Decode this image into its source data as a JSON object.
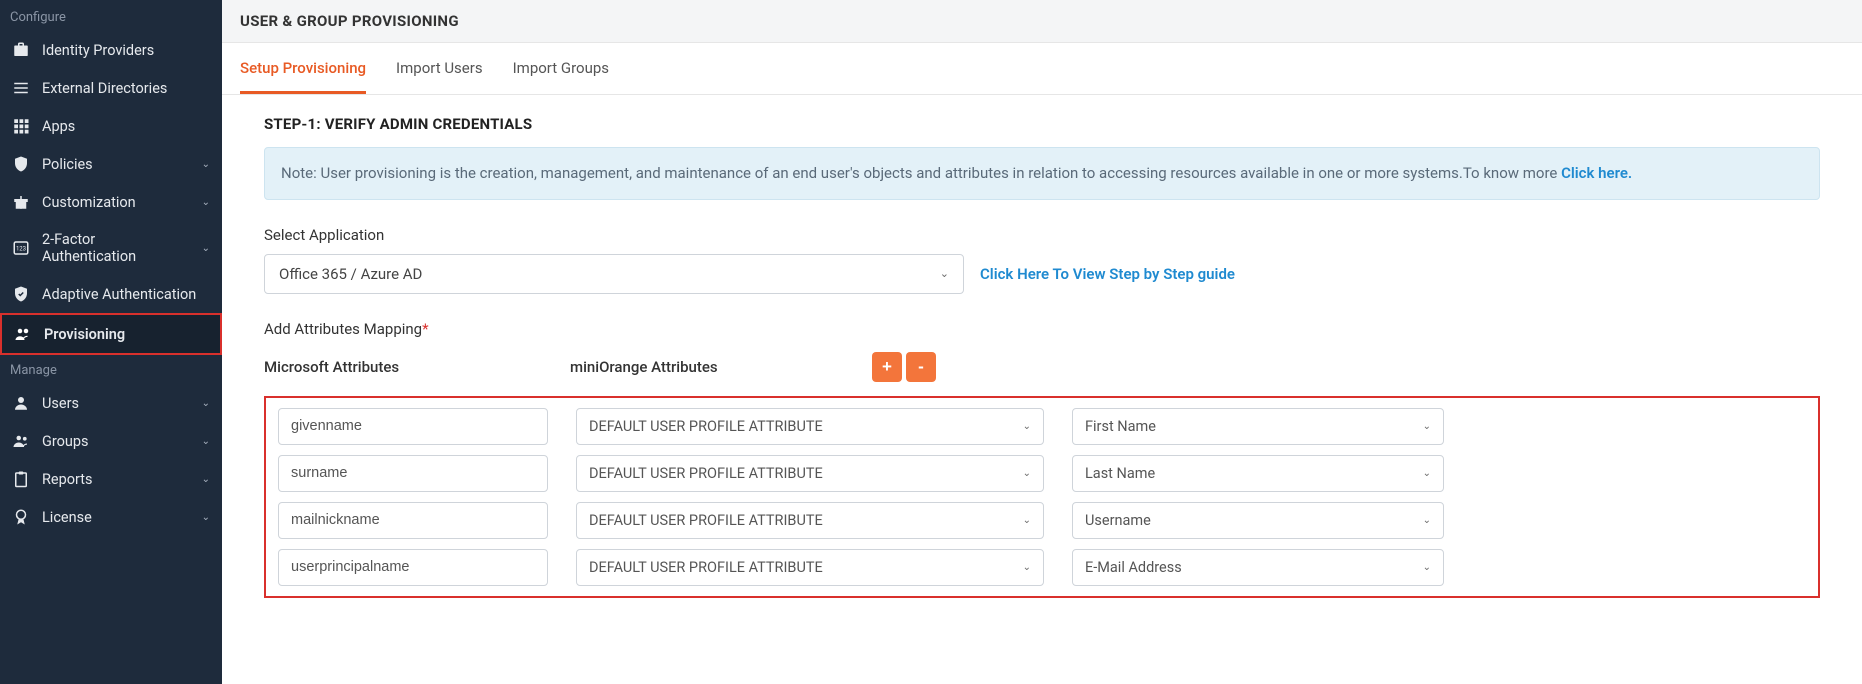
{
  "sidebar": {
    "section_configure": "Configure",
    "section_manage": "Manage",
    "items": {
      "identity_providers": "Identity Providers",
      "external_directories": "External Directories",
      "apps": "Apps",
      "policies": "Policies",
      "customization": "Customization",
      "two_factor_auth": "2-Factor Authentication",
      "adaptive_auth": "Adaptive Authentication",
      "provisioning": "Provisioning",
      "users": "Users",
      "groups": "Groups",
      "reports": "Reports",
      "license": "License"
    }
  },
  "header": {
    "title": "USER & GROUP PROVISIONING"
  },
  "tabs": {
    "setup": "Setup Provisioning",
    "import_users": "Import Users",
    "import_groups": "Import Groups"
  },
  "step": {
    "title": "STEP-1: VERIFY ADMIN CREDENTIALS"
  },
  "note": {
    "text": "Note: User provisioning is the creation, management, and maintenance of an end user's objects and attributes in relation to accessing resources available in one or more systems.To know more ",
    "link": "Click here."
  },
  "select_app": {
    "label": "Select Application",
    "value": "Office 365 / Azure AD",
    "guide_link": "Click Here To View Step by Step guide"
  },
  "attr": {
    "label": "Add Attributes Mapping",
    "col_ms": "Microsoft Attributes",
    "col_mo": "miniOrange Attributes",
    "add": "+",
    "remove": "-",
    "rows": [
      {
        "ms": "givenname",
        "type": "DEFAULT USER PROFILE ATTRIBUTE",
        "mo": "First Name"
      },
      {
        "ms": "surname",
        "type": "DEFAULT USER PROFILE ATTRIBUTE",
        "mo": "Last Name"
      },
      {
        "ms": "mailnickname",
        "type": "DEFAULT USER PROFILE ATTRIBUTE",
        "mo": "Username"
      },
      {
        "ms": "userprincipalname",
        "type": "DEFAULT USER PROFILE ATTRIBUTE",
        "mo": "E-Mail Address"
      }
    ]
  }
}
